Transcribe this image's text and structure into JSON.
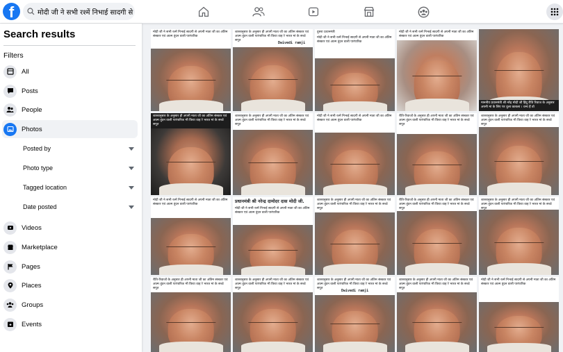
{
  "topbar": {
    "logo_letter": "f",
    "search_value": "मोदी जी ने सभी रश्में निभाई सादगी से आ"
  },
  "sidebar": {
    "title": "Search results",
    "filters_label": "Filters",
    "items": [
      {
        "label": "All",
        "icon": "feed-icon"
      },
      {
        "label": "Posts",
        "icon": "posts-icon"
      },
      {
        "label": "People",
        "icon": "people-icon"
      },
      {
        "label": "Photos",
        "icon": "photos-icon",
        "active": true
      }
    ],
    "photo_filters": [
      {
        "label": "Posted by"
      },
      {
        "label": "Photo type"
      },
      {
        "label": "Tagged location"
      },
      {
        "label": "Date posted"
      }
    ],
    "items_after": [
      {
        "label": "Videos",
        "icon": "video-icon"
      },
      {
        "label": "Marketplace",
        "icon": "marketplace-icon"
      },
      {
        "label": "Pages",
        "icon": "flag-icon"
      },
      {
        "label": "Places",
        "icon": "pin-icon"
      },
      {
        "label": "Groups",
        "icon": "groups-icon"
      },
      {
        "label": "Events",
        "icon": "calendar-icon"
      }
    ]
  },
  "captions": {
    "a": "मोदी जी ने सभी रश्में निभाई सादगी से अपनी माता जी का अंतिम संस्कार एवं आत्म तुंदन वाली पारंपारिक",
    "b": "शास्त्रानुसार के अनुसार ही अपनी माता जी का अंतिम संस्कार एवं आत्म तुंदन वाली पारंपारिक भी किया वाह रे भारत मां के सच्चे सपूत",
    "c": "रीति-रिवाजों के अनुसार ही अपनी माता जी का अंतिम संस्कार एवं आत्म तुंदन वाली पारंपारिक भी किया वाह रे भारत मां के सच्चे सपूत",
    "d": "दुसरा प्रधानमंत्री",
    "e": "माननीय प्रधानमंत्री श्री नरेंद्र मोदी जी हिंदू रीति रिवाज के अनुसार अपनी मां के लिए पर धुला काबला । धन्य हैं वो",
    "f": "प्रधानमंत्री श्री नरेन्द्र दामोदर दास मोदी जी.",
    "tag": "Dwivedi ramji"
  }
}
